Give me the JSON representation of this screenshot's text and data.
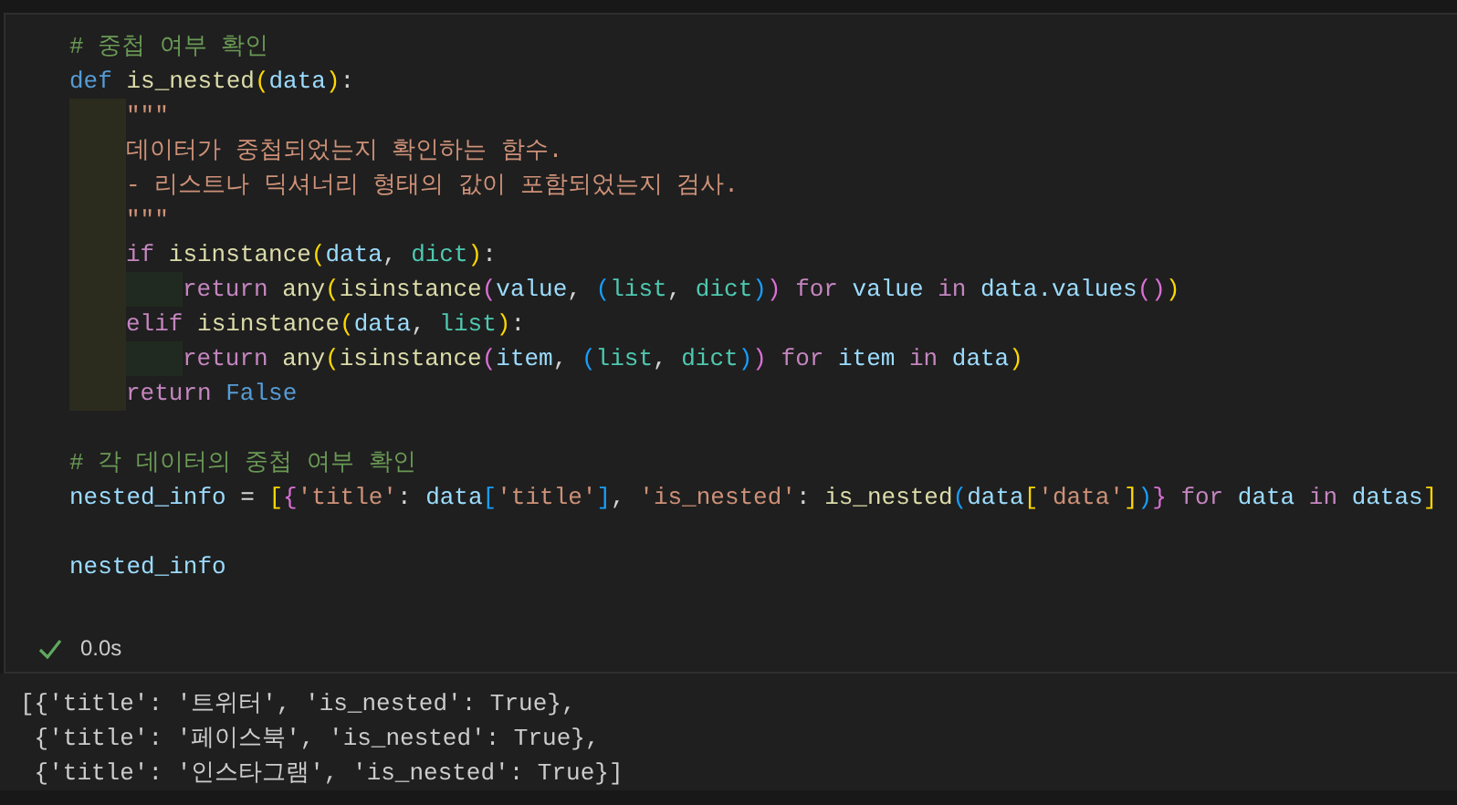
{
  "cell": {
    "lines": [
      {
        "kind": "code",
        "tokens": [
          {
            "kind": "comment",
            "text": "# 중첩 여부 확인"
          }
        ]
      },
      {
        "kind": "code",
        "tokens": [
          {
            "kind": "keyword",
            "text": "def "
          },
          {
            "kind": "function",
            "text": "is_nested"
          },
          {
            "kind": "bracket1",
            "text": "("
          },
          {
            "kind": "variable",
            "text": "data"
          },
          {
            "kind": "bracket1",
            "text": ")"
          },
          {
            "kind": "plain",
            "text": ":"
          }
        ],
        "children": [
          {
            "kind": "code",
            "tokens": [
              {
                "kind": "string",
                "text": "\"\"\""
              }
            ]
          },
          {
            "kind": "code",
            "tokens": [
              {
                "kind": "string",
                "text": "데이터가 중첩되었는지 확인하는 함수."
              }
            ]
          },
          {
            "kind": "code",
            "tokens": [
              {
                "kind": "string",
                "text": "- 리스트나 딕셔너리 형태의 값이 포함되었는지 검사."
              }
            ]
          },
          {
            "kind": "code",
            "tokens": [
              {
                "kind": "string",
                "text": "\"\"\""
              }
            ]
          },
          {
            "kind": "code",
            "tokens": [
              {
                "kind": "control",
                "text": "if "
              },
              {
                "kind": "function",
                "text": "isinstance"
              },
              {
                "kind": "bracket1",
                "text": "("
              },
              {
                "kind": "variable",
                "text": "data"
              },
              {
                "kind": "plain",
                "text": ", "
              },
              {
                "kind": "type",
                "text": "dict"
              },
              {
                "kind": "bracket1",
                "text": ")"
              },
              {
                "kind": "plain",
                "text": ":"
              }
            ],
            "children": [
              {
                "kind": "code",
                "tokens": [
                  {
                    "kind": "control",
                    "text": "return "
                  },
                  {
                    "kind": "function",
                    "text": "any"
                  },
                  {
                    "kind": "bracket1",
                    "text": "("
                  },
                  {
                    "kind": "function",
                    "text": "isinstance"
                  },
                  {
                    "kind": "bracket2",
                    "text": "("
                  },
                  {
                    "kind": "variable",
                    "text": "value"
                  },
                  {
                    "kind": "plain",
                    "text": ", "
                  },
                  {
                    "kind": "bracket3",
                    "text": "("
                  },
                  {
                    "kind": "type",
                    "text": "list"
                  },
                  {
                    "kind": "plain",
                    "text": ", "
                  },
                  {
                    "kind": "type",
                    "text": "dict"
                  },
                  {
                    "kind": "bracket3",
                    "text": ")"
                  },
                  {
                    "kind": "bracket2",
                    "text": ")"
                  },
                  {
                    "kind": "control",
                    "text": " for "
                  },
                  {
                    "kind": "variable",
                    "text": "value "
                  },
                  {
                    "kind": "control",
                    "text": "in "
                  },
                  {
                    "kind": "variable",
                    "text": "data.values"
                  },
                  {
                    "kind": "bracket2",
                    "text": "()"
                  },
                  {
                    "kind": "bracket1",
                    "text": ")"
                  }
                ]
              }
            ]
          },
          {
            "kind": "code",
            "tokens": [
              {
                "kind": "control",
                "text": "elif "
              },
              {
                "kind": "function",
                "text": "isinstance"
              },
              {
                "kind": "bracket1",
                "text": "("
              },
              {
                "kind": "variable",
                "text": "data"
              },
              {
                "kind": "plain",
                "text": ", "
              },
              {
                "kind": "type",
                "text": "list"
              },
              {
                "kind": "bracket1",
                "text": ")"
              },
              {
                "kind": "plain",
                "text": ":"
              }
            ],
            "children": [
              {
                "kind": "code",
                "tokens": [
                  {
                    "kind": "control",
                    "text": "return "
                  },
                  {
                    "kind": "function",
                    "text": "any"
                  },
                  {
                    "kind": "bracket1",
                    "text": "("
                  },
                  {
                    "kind": "function",
                    "text": "isinstance"
                  },
                  {
                    "kind": "bracket2",
                    "text": "("
                  },
                  {
                    "kind": "variable",
                    "text": "item"
                  },
                  {
                    "kind": "plain",
                    "text": ", "
                  },
                  {
                    "kind": "bracket3",
                    "text": "("
                  },
                  {
                    "kind": "type",
                    "text": "list"
                  },
                  {
                    "kind": "plain",
                    "text": ", "
                  },
                  {
                    "kind": "type",
                    "text": "dict"
                  },
                  {
                    "kind": "bracket3",
                    "text": ")"
                  },
                  {
                    "kind": "bracket2",
                    "text": ")"
                  },
                  {
                    "kind": "control",
                    "text": " for "
                  },
                  {
                    "kind": "variable",
                    "text": "item "
                  },
                  {
                    "kind": "control",
                    "text": "in "
                  },
                  {
                    "kind": "variable",
                    "text": "data"
                  },
                  {
                    "kind": "bracket1",
                    "text": ")"
                  }
                ]
              }
            ]
          },
          {
            "kind": "code",
            "tokens": [
              {
                "kind": "control",
                "text": "return "
              },
              {
                "kind": "keyword",
                "text": "False"
              }
            ]
          }
        ]
      },
      {
        "kind": "blank"
      },
      {
        "kind": "code",
        "tokens": [
          {
            "kind": "comment",
            "text": "# 각 데이터의 중첩 여부 확인"
          }
        ]
      },
      {
        "kind": "code",
        "tokens": [
          {
            "kind": "variable",
            "text": "nested_info"
          },
          {
            "kind": "plain",
            "text": " = "
          },
          {
            "kind": "bracket1",
            "text": "["
          },
          {
            "kind": "bracket2",
            "text": "{"
          },
          {
            "kind": "string",
            "text": "'title'"
          },
          {
            "kind": "plain",
            "text": ": "
          },
          {
            "kind": "variable",
            "text": "data"
          },
          {
            "kind": "bracket3",
            "text": "["
          },
          {
            "kind": "string",
            "text": "'title'"
          },
          {
            "kind": "bracket3",
            "text": "]"
          },
          {
            "kind": "plain",
            "text": ", "
          },
          {
            "kind": "string",
            "text": "'is_nested'"
          },
          {
            "kind": "plain",
            "text": ": "
          },
          {
            "kind": "function",
            "text": "is_nested"
          },
          {
            "kind": "bracket3",
            "text": "("
          },
          {
            "kind": "variable",
            "text": "data"
          },
          {
            "kind": "bracket1",
            "text": "["
          },
          {
            "kind": "string",
            "text": "'data'"
          },
          {
            "kind": "bracket1",
            "text": "]"
          },
          {
            "kind": "bracket3",
            "text": ")"
          },
          {
            "kind": "bracket2",
            "text": "}"
          },
          {
            "kind": "control",
            "text": " for "
          },
          {
            "kind": "variable",
            "text": "data "
          },
          {
            "kind": "control",
            "text": "in "
          },
          {
            "kind": "variable",
            "text": "datas"
          },
          {
            "kind": "bracket1",
            "text": "]"
          }
        ]
      },
      {
        "kind": "blank"
      },
      {
        "kind": "code",
        "tokens": [
          {
            "kind": "variable",
            "text": "nested_info"
          }
        ]
      }
    ],
    "status": {
      "succeeded": true,
      "duration": "0.0s"
    }
  },
  "output": [
    "[{'title': '트위터', 'is_nested': True},",
    " {'title': '페이스북', 'is_nested': True},",
    " {'title': '인스타그램', 'is_nested': True}]"
  ]
}
